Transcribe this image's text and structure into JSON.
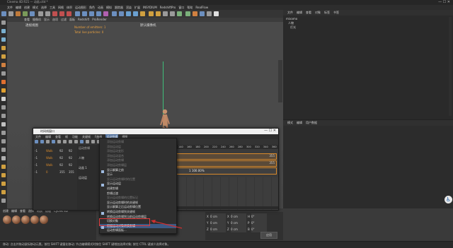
{
  "window": {
    "title": "Cinema 4D R21 — 动画.c4d *"
  },
  "main_menu": [
    "文件",
    "编辑",
    "创建",
    "模式",
    "选择",
    "工具",
    "网格",
    "体积",
    "运动图形",
    "角色",
    "动画",
    "模拟",
    "跟踪器",
    "渲染",
    "扩展",
    "INSYDIUM",
    "RedshiftPro",
    "窗口",
    "帮助",
    "RealFlow"
  ],
  "viewport": {
    "menu": [
      "查看",
      "摄像机",
      "显示",
      "选项",
      "过滤",
      "面板",
      "Redshift",
      "ProRender"
    ],
    "label": "透视视图",
    "camera_label": "默认摄像机",
    "overlay_lines": [
      "Number of emitters: 1",
      "Total live particles: 0"
    ]
  },
  "object_manager": {
    "menu": [
      "文件",
      "编辑",
      "查看",
      "对象",
      "标签",
      "书签"
    ],
    "rows": [
      "mixamo",
      "人物",
      "灯光"
    ]
  },
  "attr_manager": {
    "menu": [
      "模式",
      "编辑",
      "用户数据"
    ]
  },
  "timeline_window": {
    "title": "时间线窗口",
    "menu": [
      "文件",
      "编辑",
      "查看",
      "帧",
      "功能",
      "关键帧",
      "F曲线",
      "运动剪辑",
      "视图"
    ],
    "active_menu": "运动剪辑",
    "ruler": [
      "60",
      "80",
      "100",
      "120",
      "140",
      "160",
      "180",
      "200",
      "220",
      "240",
      "260",
      "280",
      "300",
      "320",
      "340",
      "360"
    ],
    "rows": [
      {
        "a": "-1",
        "b": "Walk",
        "c": "92",
        "d": "92"
      },
      {
        "a": "-1",
        "b": "Walk",
        "c": "92",
        "d": "92"
      },
      {
        "a": "-1",
        "b": "Walk",
        "c": "92",
        "d": "92"
      },
      {
        "a": "-1",
        "b": "0",
        "c": "355",
        "d": "355"
      }
    ],
    "clip_label": "运动剪辑",
    "clip_values": [
      "355",
      "355"
    ],
    "percent": "1   100.00%",
    "track_items": [
      "人物",
      "动画 1",
      "运动层"
    ]
  },
  "motion_menu": {
    "items": [
      {
        "t": "添加运动剪辑",
        "dim": true
      },
      {
        "t": "添加运动层",
        "dim": true
      },
      {
        "t": "添加运动变形",
        "dim": true
      },
      {
        "t": "添加运动混合",
        "dim": true
      },
      {
        "t": "添加运动剪辑",
        "dim": true
      },
      {
        "t": "添加运动剪辑层",
        "dim": true
      },
      {
        "t": "显示解算之前",
        "dim": false
      },
      {
        "t": "显示",
        "dim": false
      },
      {
        "t": "显示运动剪辑时的位置",
        "dim": true
      },
      {
        "t": "显示运动层",
        "dim": false
      },
      {
        "t": "创建剪辑",
        "dim": false
      },
      {
        "t": "剪辑过渡",
        "dim": false
      },
      {
        "t": "显示运动剪辑的位置标记",
        "dim": true
      },
      {
        "t": "显示运动剪辑时的关键帧",
        "dim": false
      },
      {
        "t": "显示解算之后运动剪辑位置",
        "dim": false
      },
      {
        "t": "转换运动剪辑到关键帧",
        "dim": false
      },
      {
        "t": "转换运动剪辑到当前运动剪辑层",
        "dim": false
      },
      {
        "t": "切换对象",
        "dim": false
      },
      {
        "t": "根据运动对象转换剪辑",
        "dim": false
      },
      {
        "t": "运动剪辑面板...",
        "dim": false
      }
    ],
    "highlight_index": 18
  },
  "material_bar": {
    "menu": [
      "创建",
      "编辑",
      "查看",
      "选择",
      "材质",
      "纹理",
      "Cycles 4D"
    ],
    "count": 5
  },
  "coord_panel": {
    "rows": [
      [
        "X",
        "0 cm",
        "X",
        "0 cm",
        "H",
        "0°"
      ],
      [
        "Y",
        "0 cm",
        "Y",
        "0 cm",
        "P",
        "0°"
      ],
      [
        "Z",
        "0 cm",
        "Z",
        "0 cm",
        "B",
        "0°"
      ]
    ],
    "apply": "应用"
  },
  "status_bar": "移动: 点击并拖动鼠标移动元素。按住 SHIFT 键量化移动; 节点编辑模式时按住 SHIFT 键增加选择对象; 按住 CTRL 键减少选择对象。",
  "colors": {
    "accent": "#e08a2e",
    "highlight_box": "#e23b3b",
    "arrow": "#d22f2f",
    "track_orange": "#d98a2b"
  }
}
